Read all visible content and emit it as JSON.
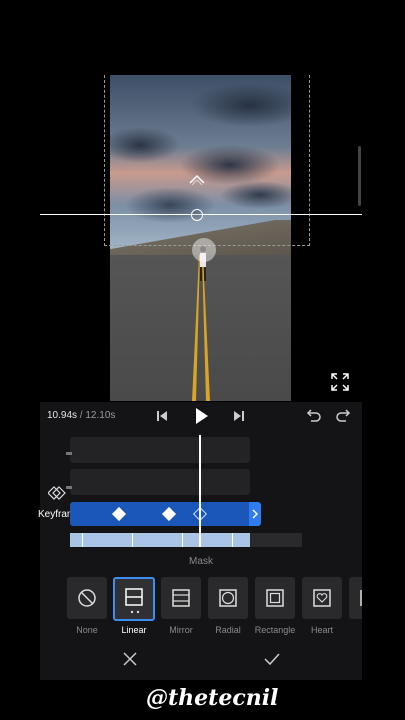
{
  "timeline": {
    "current_time": "10.94s",
    "separator": " / ",
    "total_time": "12.10s"
  },
  "keyframe": {
    "label": "Keyframe"
  },
  "mask": {
    "title": "Mask",
    "options": [
      {
        "label": "None",
        "icon": "circle-slash-icon"
      },
      {
        "label": "Linear",
        "icon": "linear-mask-icon",
        "selected": true
      },
      {
        "label": "Mirror",
        "icon": "mirror-mask-icon"
      },
      {
        "label": "Radial",
        "icon": "radial-mask-icon"
      },
      {
        "label": "Rectangle",
        "icon": "rectangle-mask-icon"
      },
      {
        "label": "Heart",
        "icon": "heart-mask-icon"
      }
    ]
  },
  "watermark": "@thetecnil",
  "colors": {
    "accent": "#3a8ff0",
    "track": "#1a57b8",
    "panel": "#141416"
  }
}
